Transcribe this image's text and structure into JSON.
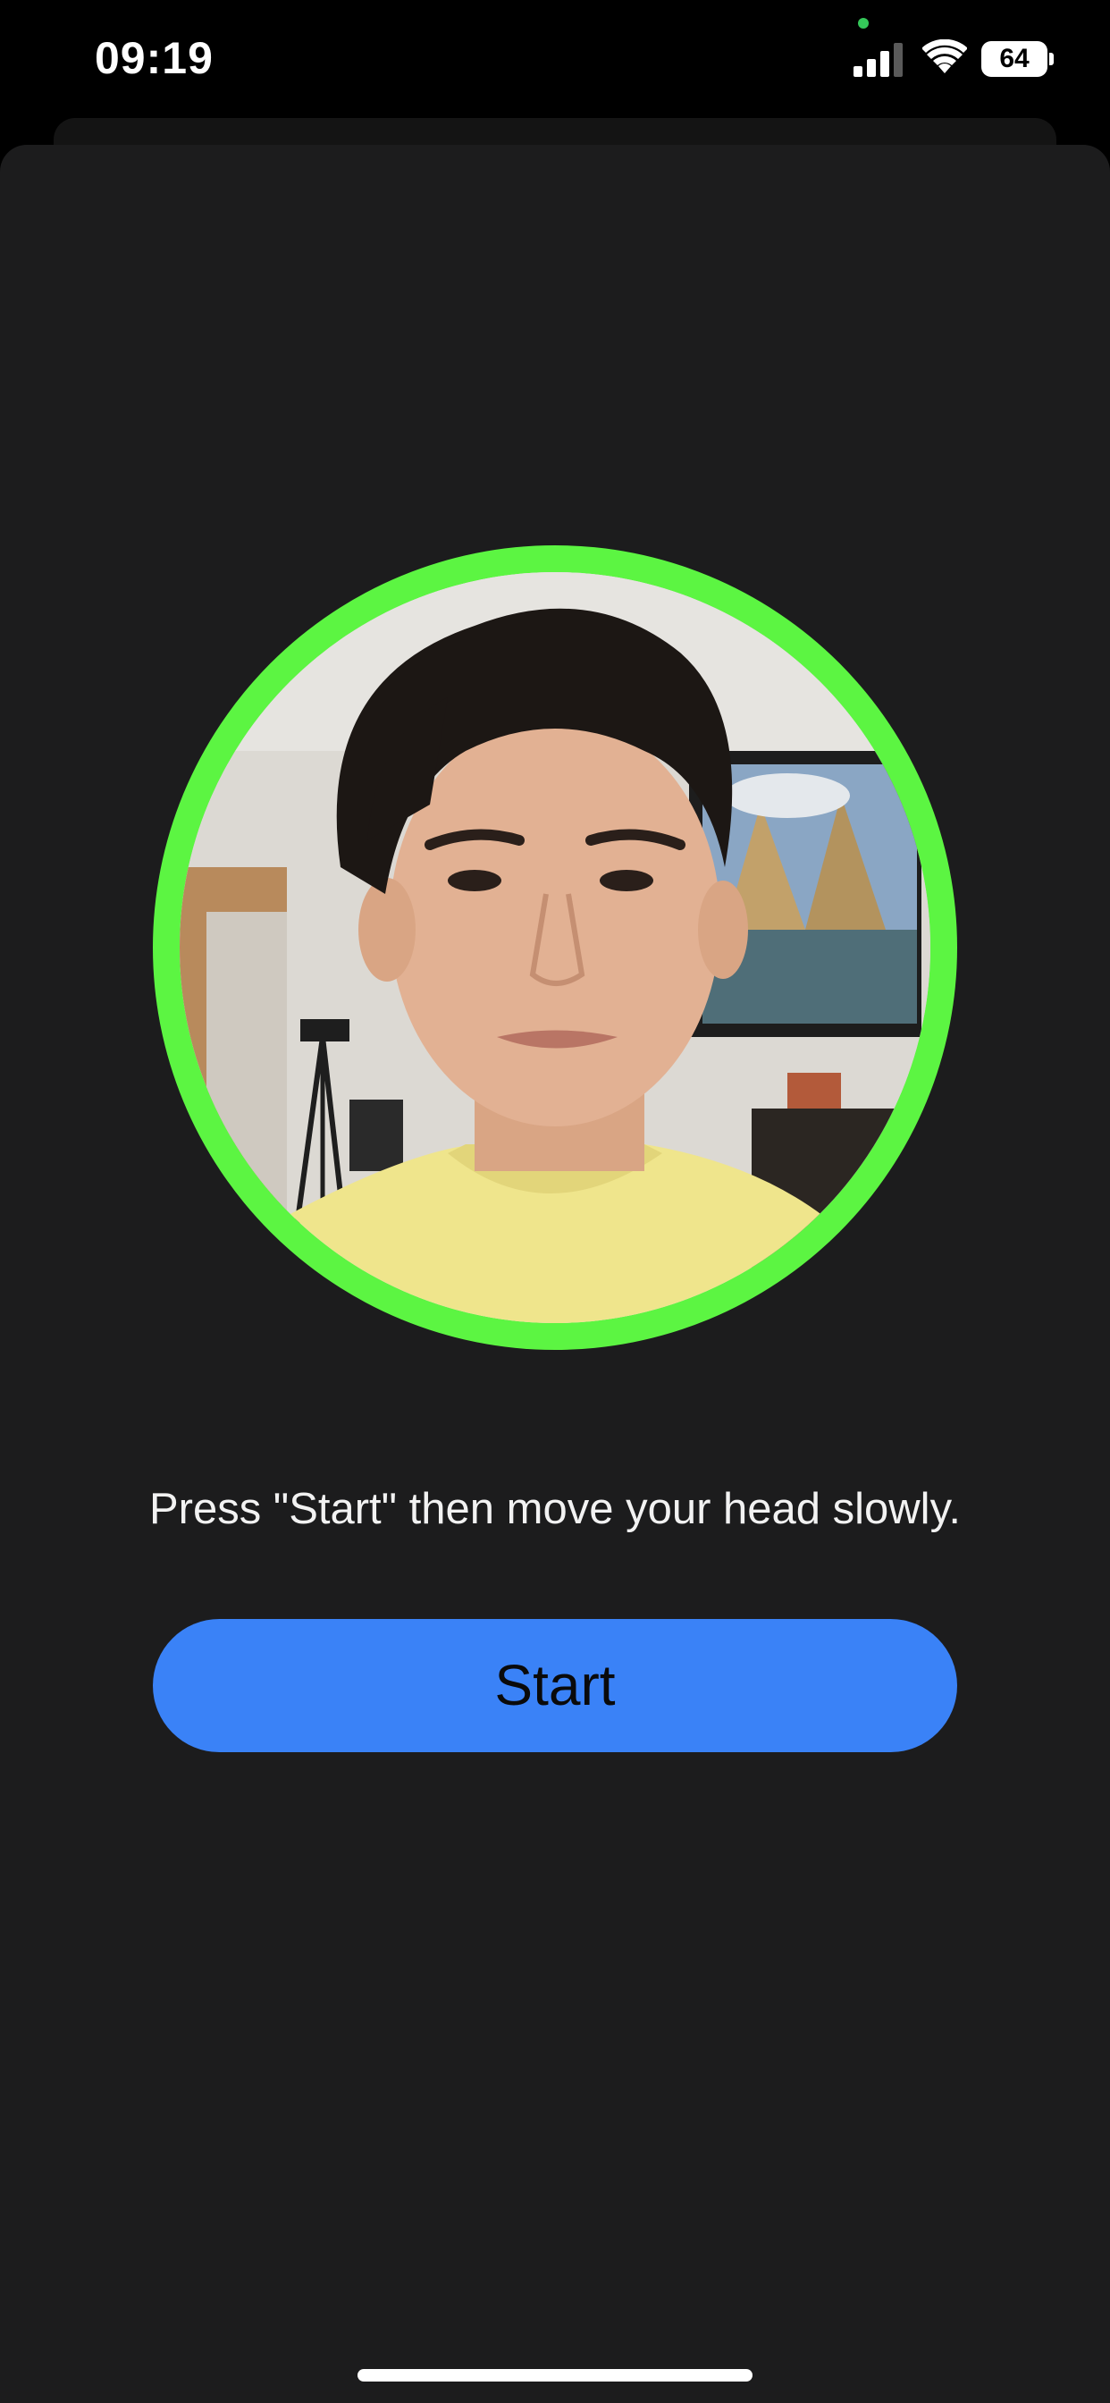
{
  "status_bar": {
    "time": "09:19",
    "battery_level": "64",
    "icons": [
      "cellular-signal-icon",
      "wifi-icon",
      "battery-icon"
    ]
  },
  "camera": {
    "ring_color": "#5cf542",
    "state": "face-detected"
  },
  "instruction": "Press \"Start\" then move your head slowly.",
  "start_button": {
    "label": "Start",
    "color": "#3a82f7"
  }
}
